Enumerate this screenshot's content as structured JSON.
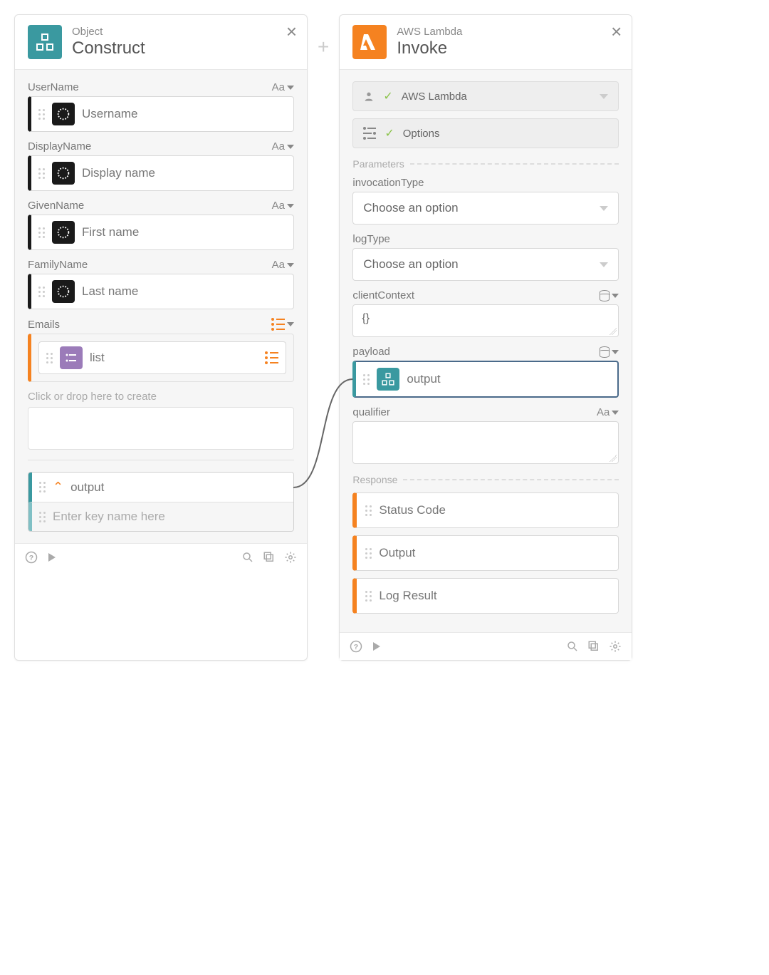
{
  "leftCard": {
    "suptitle": "Object",
    "title": "Construct",
    "fields": [
      {
        "label": "UserName",
        "type": "Aa",
        "chip": "Username",
        "chipKind": "okta"
      },
      {
        "label": "DisplayName",
        "type": "Aa",
        "chip": "Display name",
        "chipKind": "okta"
      },
      {
        "label": "GivenName",
        "type": "Aa",
        "chip": "First name",
        "chipKind": "okta"
      },
      {
        "label": "FamilyName",
        "type": "Aa",
        "chip": "Last name",
        "chipKind": "okta"
      }
    ],
    "emailsLabel": "Emails",
    "emailsChip": "list",
    "dropPlaceholder": "Click or drop here to create",
    "output": {
      "label": "output",
      "keyPlaceholder": "Enter key name here"
    }
  },
  "rightCard": {
    "suptitle": "AWS Lambda",
    "title": "Invoke",
    "connection": "AWS Lambda",
    "options": "Options",
    "parametersTitle": "Parameters",
    "invocationTypeLabel": "invocationType",
    "invocationTypePlaceholder": "Choose an option",
    "logTypeLabel": "logType",
    "logTypePlaceholder": "Choose an option",
    "clientContextLabel": "clientContext",
    "clientContextValue": "{}",
    "payloadLabel": "payload",
    "payloadChip": "output",
    "qualifierLabel": "qualifier",
    "responseTitle": "Response",
    "responses": [
      "Status Code",
      "Output",
      "Log Result"
    ]
  }
}
